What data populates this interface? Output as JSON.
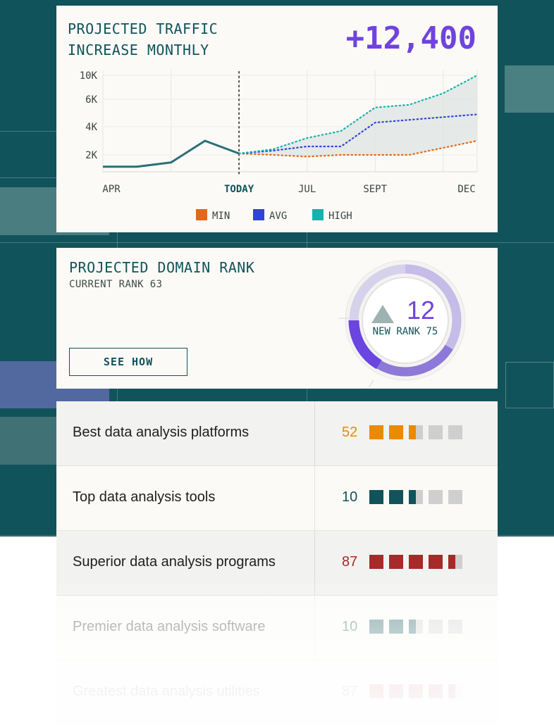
{
  "traffic": {
    "title_line1": "PROJECTED TRAFFIC",
    "title_line2": "INCREASE MONTHLY",
    "total": "+12,400"
  },
  "chart_data": {
    "type": "line",
    "y_ticks": [
      "10K",
      "6K",
      "4K",
      "2K"
    ],
    "x_ticks": [
      "APR",
      "TODAY",
      "JUL",
      "SEPT",
      "DEC"
    ],
    "legend": [
      "MIN",
      "AVG",
      "HIGH"
    ],
    "colors": {
      "actual": "#2a6f77",
      "min": "#e0691d",
      "avg": "#3145d1",
      "high": "#16b3ad",
      "band": "#dde3e2"
    },
    "x": [
      0,
      1,
      2,
      3,
      4,
      5,
      6,
      7,
      8,
      9,
      10,
      11
    ],
    "actual": [
      600,
      600,
      1100,
      3000,
      2100
    ],
    "series": [
      {
        "name": "MIN",
        "values": [
          2100,
          2000,
          1800,
          2000,
          2000,
          2000,
          2500,
          3000
        ]
      },
      {
        "name": "AVG",
        "values": [
          2100,
          2300,
          2600,
          2600,
          4300,
          4500,
          4700,
          4900
        ]
      },
      {
        "name": "HIGH",
        "values": [
          2100,
          2400,
          3200,
          3700,
          5400,
          5600,
          7000,
          10000
        ]
      }
    ],
    "y_scale": "tick-spaced",
    "grid": true
  },
  "rank": {
    "title": "PROJECTED DOMAIN RANK",
    "current": "CURRENT RANK 63",
    "button": "SEE HOW",
    "delta": "12",
    "new_rank": "NEW RANK 75",
    "progress_fraction": 0.75
  },
  "keywords": [
    {
      "label": "Best data analysis platforms",
      "score": "52",
      "color": "#ea8a00",
      "level": 2.5,
      "opacity": 1
    },
    {
      "label": "Top data analysis tools",
      "score": "10",
      "color": "#11535a",
      "level": 2.5,
      "opacity": 1
    },
    {
      "label": "Superior data analysis programs",
      "score": "87",
      "color": "#a72929",
      "level": 4.5,
      "opacity": 1
    },
    {
      "label": "Premier data analysis software",
      "score": "10",
      "color": "#11535a",
      "level": 2.5,
      "opacity": 0.5
    },
    {
      "label": "Greatest data analysis utilities",
      "score": "87",
      "color": "#a72929",
      "level": 4.5,
      "opacity": 0.2
    }
  ]
}
